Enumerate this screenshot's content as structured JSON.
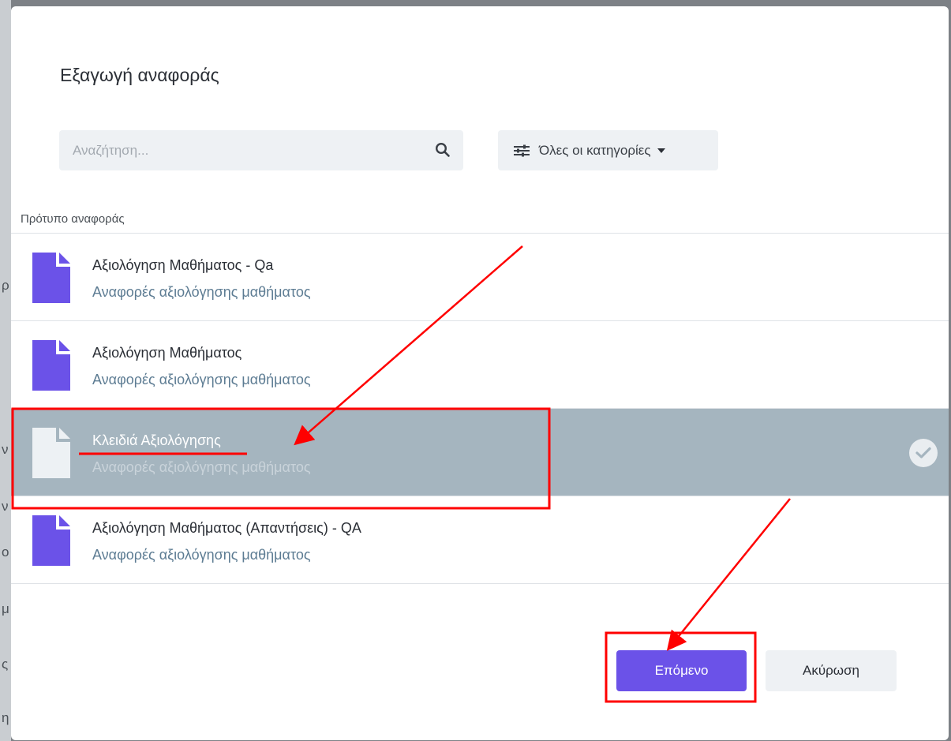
{
  "dialog": {
    "title": "Εξαγωγή αναφοράς",
    "search_placeholder": "Αναζήτηση...",
    "filter_label": "Όλες οι κατηγορίες",
    "section_label": "Πρότυπο αναφοράς"
  },
  "templates": [
    {
      "name": "Αξιολόγηση Μαθήματος - Qa",
      "category": "Αναφορές αξιολόγησης μαθήματος",
      "selected": false
    },
    {
      "name": "Αξιολόγηση Μαθήματος",
      "category": "Αναφορές αξιολόγησης μαθήματος",
      "selected": false
    },
    {
      "name": "Κλειδιά Αξιολόγησης",
      "category": "Αναφορές αξιολόγησης μαθήματος",
      "selected": true
    },
    {
      "name": "Αξιολόγηση Μαθήματος (Απαντήσεις) - QA",
      "category": "Αναφορές αξιολόγησης μαθήματος",
      "selected": false
    }
  ],
  "buttons": {
    "next": "Επόμενο",
    "cancel": "Ακύρωση"
  },
  "colors": {
    "accent": "#6b52e8",
    "selected_row": "#a5b5bf",
    "annotation": "#ff0000"
  }
}
